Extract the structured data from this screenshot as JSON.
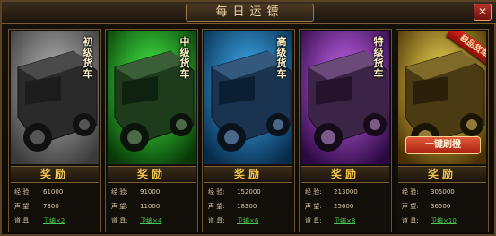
{
  "window": {
    "title": "每日运镖",
    "close_glyph": "✕"
  },
  "cards": [
    {
      "grade": "初级货车",
      "reward_title": "奖励",
      "exp_label": "经 验:",
      "exp": "61000",
      "rep_label": "声 望:",
      "rep": "7300",
      "item_label": "道 具:",
      "item": "卫编×2",
      "theme_color": "#c9c9c9",
      "selected": true
    },
    {
      "grade": "中级货车",
      "reward_title": "奖励",
      "exp_label": "经 验:",
      "exp": "91000",
      "rep_label": "声 望:",
      "rep": "11000",
      "item_label": "道 具:",
      "item": "卫编×4",
      "theme_color": "#2fc23a"
    },
    {
      "grade": "高级货车",
      "reward_title": "奖励",
      "exp_label": "经 验:",
      "exp": "152000",
      "rep_label": "声 望:",
      "rep": "18300",
      "item_label": "道 具:",
      "item": "卫编×6",
      "theme_color": "#2f8fe8"
    },
    {
      "grade": "特级货车",
      "reward_title": "奖励",
      "exp_label": "经 验:",
      "exp": "213000",
      "rep_label": "声 望:",
      "rep": "25600",
      "item_label": "道 具:",
      "item": "卫编×8",
      "theme_color": "#a542d8"
    },
    {
      "grade": "",
      "reward_title": "奖励",
      "exp_label": "经 验:",
      "exp": "305000",
      "rep_label": "声 望:",
      "rep": "36500",
      "item_label": "道 具:",
      "item": "卫编×10",
      "theme_color": "#e8b21a",
      "ribbon": "极品货车",
      "refresh_button": "一键刷橙"
    }
  ]
}
